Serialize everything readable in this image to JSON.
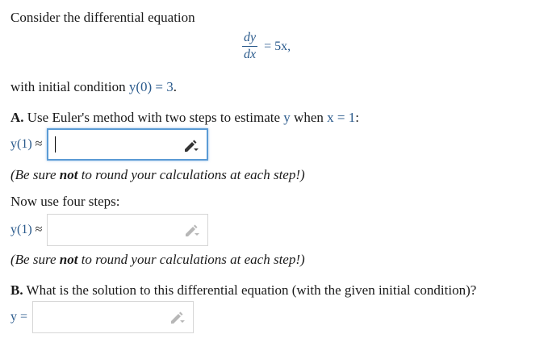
{
  "intro": "Consider the differential equation",
  "equation": {
    "numerator": "dy",
    "denominator": "dx",
    "rhs": "= 5x,"
  },
  "initial_condition": {
    "prefix": "with initial condition ",
    "math": "y(0) = 3",
    "suffix": "."
  },
  "part_a": {
    "letter": "A.",
    "text": " Use Euler's method with two steps to estimate ",
    "var_y": "y",
    "when": " when ",
    "math_x": "x = 1",
    "colon": ":"
  },
  "answer1": {
    "label_math": "y(1)",
    "approx": " ≈",
    "value": "",
    "icon": "pencil-icon"
  },
  "note1": {
    "pre": "(Be sure ",
    "bold": "not",
    "post": " to round your calculations at each step!)"
  },
  "four_steps": "Now use four steps:",
  "answer2": {
    "label_math": "y(1)",
    "approx": " ≈",
    "value": "",
    "icon": "pencil-icon"
  },
  "note2": {
    "pre": "(Be sure ",
    "bold": "not",
    "post": " to round your calculations at each step!)"
  },
  "part_b": {
    "letter": "B.",
    "text": " What is the solution to this differential equation (with the given initial condition)?"
  },
  "answer3": {
    "label_math": "y =",
    "value": "",
    "icon": "pencil-icon"
  },
  "colors": {
    "math": "#2a5a8c",
    "focus_border": "#5b9bd5",
    "input_border": "#d6d6d6"
  }
}
